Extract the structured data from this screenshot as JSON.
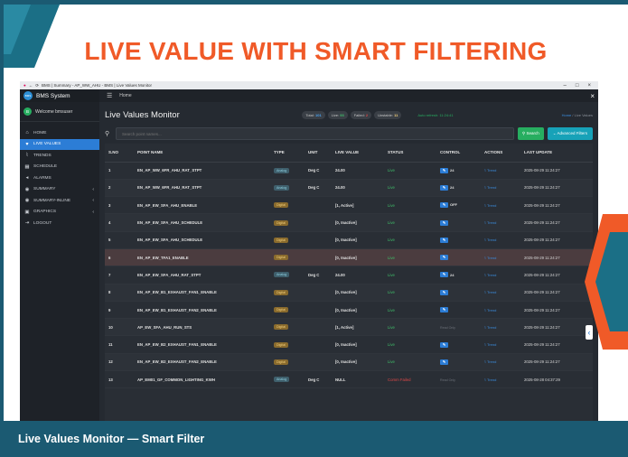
{
  "slide_title": "LIVE VALUE WITH SMART FILTERING",
  "caption": "Live Values Monitor — Smart Filter",
  "browser": {
    "address": "BMS | Summary - AP_WW_AHU - BMS | Live Values Monitor",
    "icons": [
      "reload-icon",
      "back-icon",
      "forward-icon"
    ]
  },
  "app": {
    "brand": "BMS System",
    "brand_logo": "BMS",
    "home": "Home",
    "close": "×",
    "welcome": "Welcome bmsuser",
    "avatar": "B"
  },
  "sidebar": {
    "items": [
      {
        "label": "HOME",
        "icon": "⌂",
        "active": false,
        "chevron": ""
      },
      {
        "label": "LIVE VALUES",
        "icon": "♥",
        "active": true,
        "chevron": ""
      },
      {
        "label": "TRENDS",
        "icon": "⌇",
        "active": false,
        "chevron": ""
      },
      {
        "label": "SCHEDULE",
        "icon": "▦",
        "active": false,
        "chevron": ""
      },
      {
        "label": "ALARMS",
        "icon": "◂",
        "active": false,
        "chevron": ""
      },
      {
        "label": "SUMMARY",
        "icon": "◉",
        "active": false,
        "chevron": "‹"
      },
      {
        "label": "SUMMARY-INLINE",
        "icon": "◉",
        "active": false,
        "chevron": "‹"
      },
      {
        "label": "GRAPHICS",
        "icon": "▣",
        "active": false,
        "chevron": "‹"
      },
      {
        "label": "LOGOUT",
        "icon": "⇥",
        "active": false,
        "chevron": ""
      }
    ]
  },
  "header": {
    "title": "Live Values Monitor",
    "badges": [
      {
        "label": "Total: ",
        "value": "101"
      },
      {
        "label": "Live: ",
        "value": "93"
      },
      {
        "label": "Failed: ",
        "value": "2"
      },
      {
        "label": "Unstable: ",
        "value": "11"
      }
    ],
    "status": "Auto refresh: 11:24:41",
    "breadcrumb_home": "Home",
    "breadcrumb_current": " / Live Values"
  },
  "filter": {
    "placeholder": "Search point names...",
    "search_label": "Search",
    "advanced_label": "Advanced Filters"
  },
  "table": {
    "columns": [
      "S.NO",
      "POINT NAME",
      "TYPE",
      "UNIT",
      "LIVE VALUE",
      "STATUS",
      "CONTROL",
      "ACTIONS",
      "LAST UPDATE"
    ],
    "rows": [
      {
        "sno": "1",
        "name": "EN_AP_WW_6FR_AHU_RAT_STPT",
        "type": "Analog",
        "unit": "Deg C",
        "value": "24.00",
        "status": "Live",
        "control": "24",
        "has_btn": true,
        "action": "Trend",
        "updated": "2025-08-29 11:24:27"
      },
      {
        "sno": "2",
        "name": "EN_AP_WW_6FR_AHU_RAT_STPT",
        "type": "Analog",
        "unit": "Deg C",
        "value": "24.00",
        "status": "Live",
        "control": "24",
        "has_btn": true,
        "action": "Trend",
        "updated": "2025-08-29 11:24:27"
      },
      {
        "sno": "3",
        "name": "EN_AP_EW_SFA_AHU_ENABLE",
        "type": "Digital",
        "unit": "",
        "value": "[1, Active]",
        "status": "Live",
        "control": "OFF",
        "has_btn": true,
        "action": "Trend",
        "updated": "2025-08-29 11:24:27"
      },
      {
        "sno": "4",
        "name": "EN_AP_EW_SFA_AHU_SCHEDULE",
        "type": "Digital",
        "unit": "",
        "value": "[0, Inactive]",
        "status": "Live",
        "control": "",
        "has_btn": true,
        "action": "Trend",
        "updated": "2025-08-29 11:24:27"
      },
      {
        "sno": "5",
        "name": "EN_AP_EW_SFA_AHU_SCHEDULE",
        "type": "Digital",
        "unit": "",
        "value": "[0, Inactive]",
        "status": "Live",
        "control": "",
        "has_btn": true,
        "action": "Trend",
        "updated": "2025-08-29 11:24:27"
      },
      {
        "sno": "6",
        "name": "EN_AP_EW_TFA1_ENABLE",
        "type": "Digital",
        "unit": "",
        "value": "[0, Inactive]",
        "status": "Live",
        "control": "",
        "has_btn": true,
        "action": "Trend",
        "updated": "2025-08-29 11:24:27"
      },
      {
        "sno": "7",
        "name": "EN_AP_EW_SFA_AHU_RAT_STPT",
        "type": "Analog",
        "unit": "Deg C",
        "value": "24.00",
        "status": "Live",
        "control": "24",
        "has_btn": true,
        "action": "Trend",
        "updated": "2025-08-29 11:24:27"
      },
      {
        "sno": "8",
        "name": "EN_AP_EW_B1_EXHAUST_FAN1_ENABLE",
        "type": "Digital",
        "unit": "",
        "value": "[0, Inactive]",
        "status": "Live",
        "control": "",
        "has_btn": true,
        "action": "Trend",
        "updated": "2025-08-29 11:24:27"
      },
      {
        "sno": "9",
        "name": "EN_AP_EW_B1_EXHAUST_FAN2_ENABLE",
        "type": "Digital",
        "unit": "",
        "value": "[0, Inactive]",
        "status": "Live",
        "control": "",
        "has_btn": true,
        "action": "Trend",
        "updated": "2025-08-29 11:24:27"
      },
      {
        "sno": "10",
        "name": "AP_EW_SFA_AHU_RUN_STS",
        "type": "Digital",
        "unit": "",
        "value": "[1, Active]",
        "status": "Live",
        "control": "Read Only",
        "has_btn": false,
        "action": "Trend",
        "updated": "2025-08-29 11:24:27"
      },
      {
        "sno": "11",
        "name": "EN_AP_EW_B2_EXHAUST_FAN1_ENABLE",
        "type": "Digital",
        "unit": "",
        "value": "[0, Inactive]",
        "status": "Live",
        "control": "",
        "has_btn": true,
        "action": "Trend",
        "updated": "2025-08-29 11:24:27"
      },
      {
        "sno": "12",
        "name": "EN_AP_EW_B2_EXHAUST_FAN2_ENABLE",
        "type": "Digital",
        "unit": "",
        "value": "[0, Inactive]",
        "status": "Live",
        "control": "",
        "has_btn": true,
        "action": "Trend",
        "updated": "2025-08-29 11:24:27"
      },
      {
        "sno": "13",
        "name": "AP_EM01_GF_COMMON_LIGHTING_KWH",
        "type": "Analog",
        "unit": "Deg C",
        "value": "NULL",
        "status": "Comm Failed",
        "control": "Read Only",
        "has_btn": false,
        "action": "Trend",
        "updated": "2025-08-28 04:37:29"
      }
    ]
  },
  "colors": {
    "title_orange": "#f05a28",
    "caption_bg": "#1b5a72",
    "active_blue": "#2c7dd6",
    "live_green": "#3fbf6a",
    "failed_red": "#e04848"
  }
}
